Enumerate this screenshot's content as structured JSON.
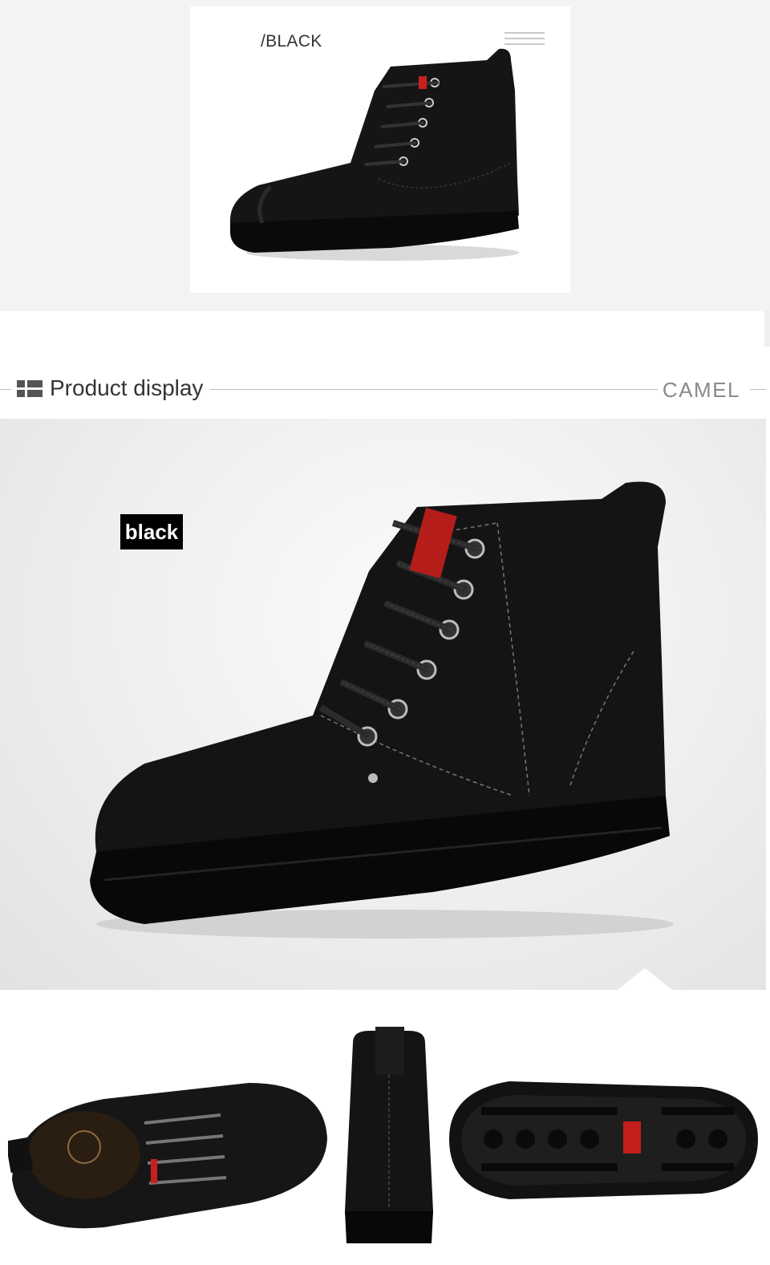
{
  "top_card": {
    "color_label": "/BLACK"
  },
  "section": {
    "title": "Product display",
    "brand": "CAMEL"
  },
  "main_view": {
    "color_badge": "black"
  }
}
